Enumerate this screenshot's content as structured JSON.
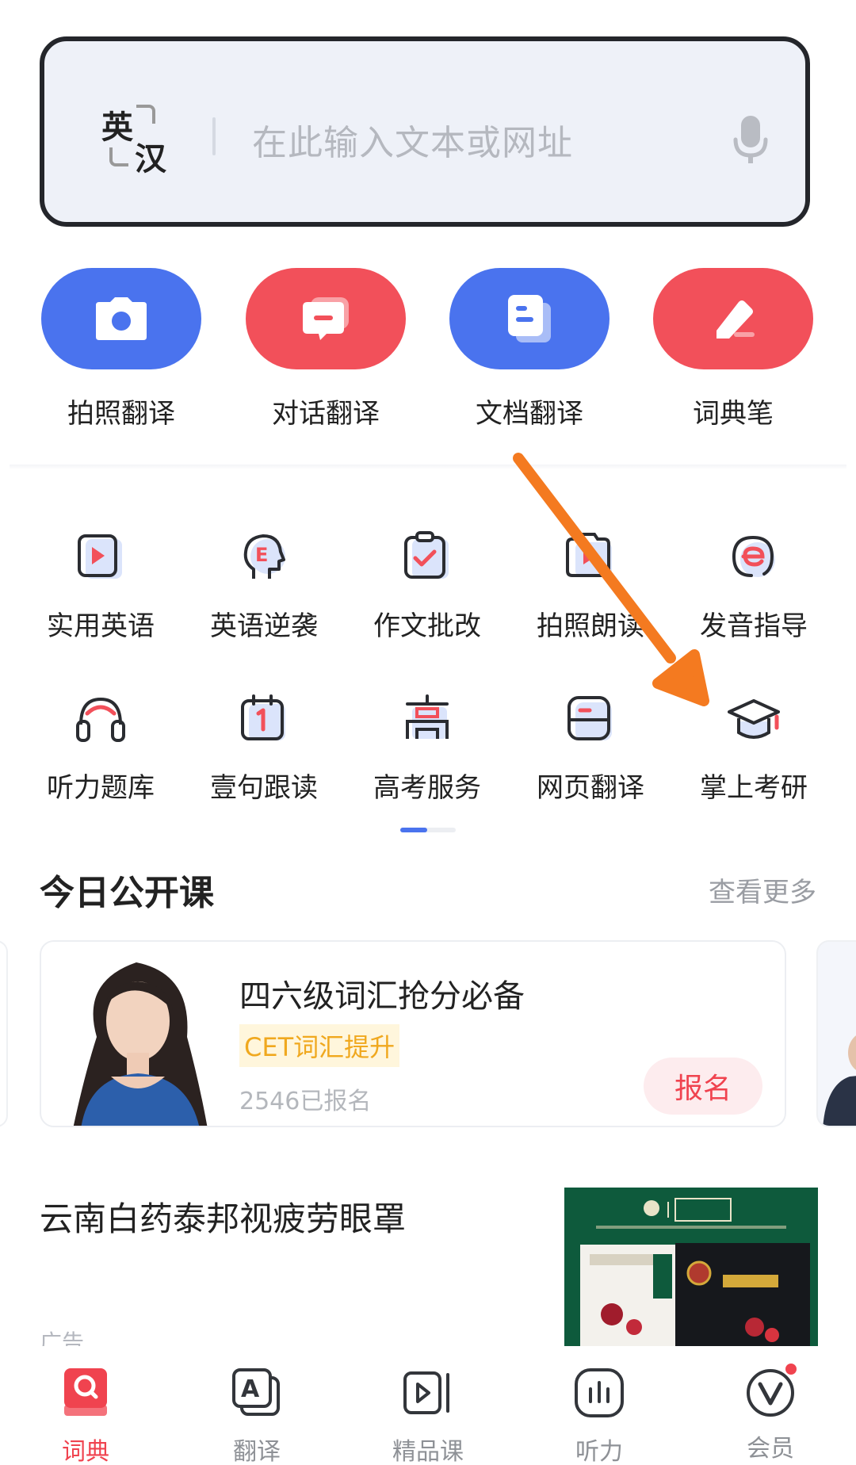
{
  "search": {
    "lang_source": "英",
    "lang_target": "汉",
    "placeholder": "在此输入文本或网址"
  },
  "primary_actions": [
    {
      "label": "拍照翻译",
      "icon": "camera-icon",
      "color": "#4a73ee"
    },
    {
      "label": "对话翻译",
      "icon": "chat-icon",
      "color": "#f2505a"
    },
    {
      "label": "文档翻译",
      "icon": "document-icon",
      "color": "#4a73ee"
    },
    {
      "label": "词典笔",
      "icon": "pen-icon",
      "color": "#f2505a"
    }
  ],
  "grid_row1": [
    {
      "label": "实用英语",
      "icon": "play-video-icon"
    },
    {
      "label": "英语逆袭",
      "icon": "head-e-icon"
    },
    {
      "label": "作文批改",
      "icon": "checklist-icon"
    },
    {
      "label": "拍照朗读",
      "icon": "photo-read-icon"
    },
    {
      "label": "发音指导",
      "icon": "pronunciation-icon"
    }
  ],
  "grid_row2": [
    {
      "label": "听力题库",
      "icon": "headphones-icon"
    },
    {
      "label": "壹句跟读",
      "icon": "calendar-one-icon"
    },
    {
      "label": "高考服务",
      "icon": "gaokao-icon"
    },
    {
      "label": "网页翻译",
      "icon": "web-page-icon"
    },
    {
      "label": "掌上考研",
      "icon": "graduation-cap-icon"
    }
  ],
  "open_course": {
    "title": "今日公开课",
    "more": "查看更多",
    "card": {
      "title": "四六级词汇抢分必备",
      "tag": "CET词汇提升",
      "count": "2546已报名",
      "button": "报名"
    }
  },
  "ad": {
    "title": "云南白药泰邦视疲劳眼罩",
    "label": "广告"
  },
  "bottom_nav": [
    {
      "label": "词典",
      "icon": "dictionary-icon",
      "active": true
    },
    {
      "label": "翻译",
      "icon": "translate-icon",
      "active": false
    },
    {
      "label": "精品课",
      "icon": "course-video-icon",
      "active": false
    },
    {
      "label": "听力",
      "icon": "listening-icon",
      "active": false
    },
    {
      "label": "会员",
      "icon": "vip-icon",
      "active": false
    }
  ],
  "colors": {
    "accent_blue": "#4a73ee",
    "accent_red": "#f2505a",
    "annotation_arrow": "#f47a20"
  }
}
